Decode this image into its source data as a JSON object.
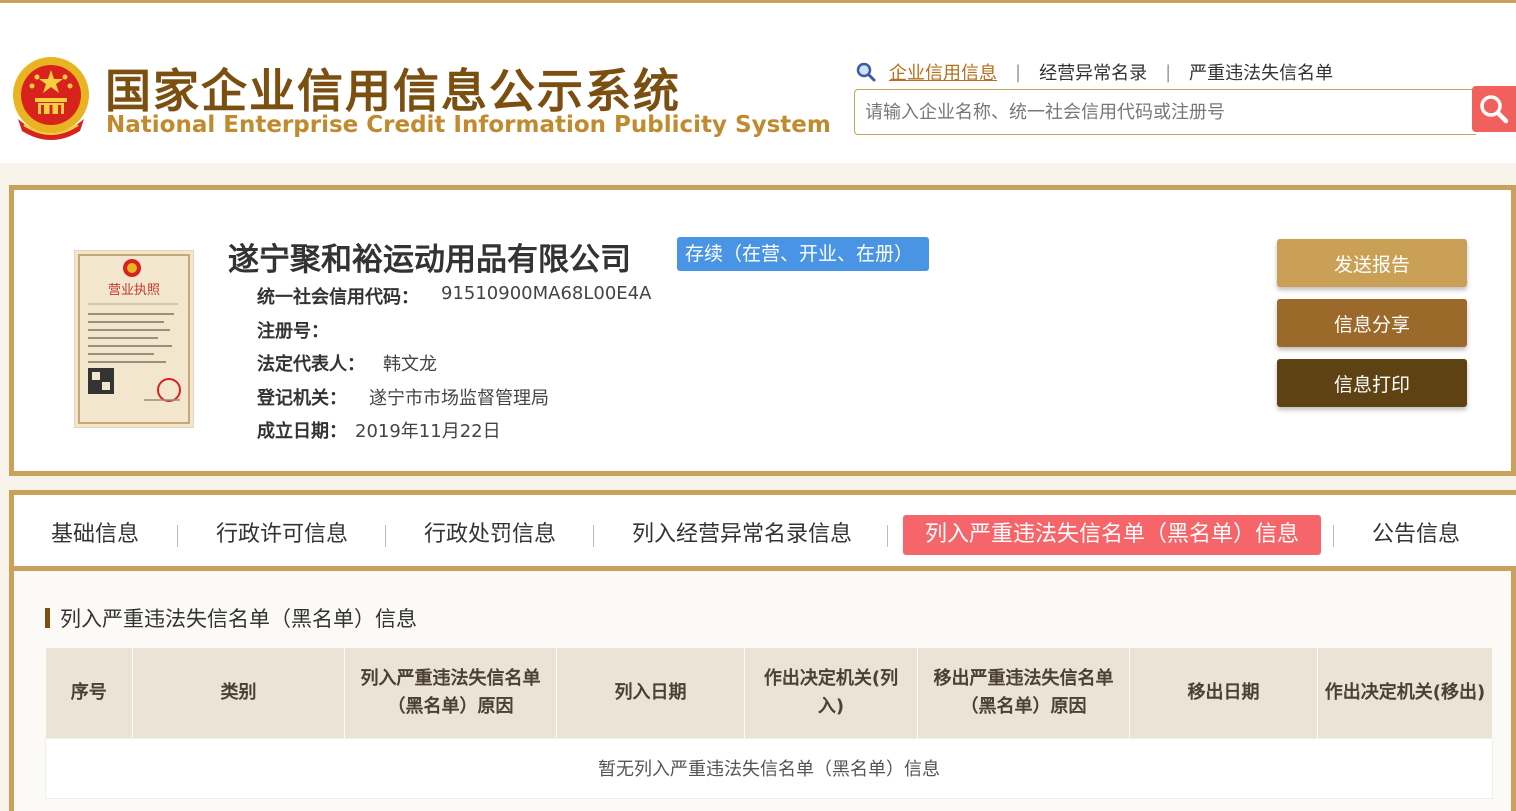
{
  "header": {
    "title": "国家企业信用信息公示系统",
    "subtitle": "National Enterprise Credit Information Publicity System",
    "nav": {
      "items": [
        "企业信用信息",
        "经营异常名录",
        "严重违法失信名单"
      ],
      "active_index": 0
    },
    "search": {
      "placeholder": "请输入企业名称、统一社会信用代码或注册号"
    }
  },
  "company": {
    "name": "遂宁聚和裕运动用品有限公司",
    "status": "存续（在营、开业、在册）",
    "license_title": "营业执照",
    "fields": [
      {
        "label": "统一社会信用代码：",
        "value": "91510900MA68L00E4A"
      },
      {
        "label": "注册号：",
        "value": ""
      },
      {
        "label": "法定代表人：",
        "value": "韩文龙"
      },
      {
        "label": "登记机关：",
        "value": "遂宁市市场监督管理局"
      },
      {
        "label": "成立日期：",
        "value": "2019年11月22日"
      }
    ],
    "actions": {
      "send": "发送报告",
      "share": "信息分享",
      "print": "信息打印"
    }
  },
  "tabs": {
    "items": [
      "基础信息",
      "行政许可信息",
      "行政处罚信息",
      "列入经营异常名录信息",
      "列入严重违法失信名单（黑名单）信息",
      "公告信息"
    ],
    "active_index": 4
  },
  "section": {
    "title": "列入严重违法失信名单（黑名单）信息",
    "table": {
      "columns": [
        "序号",
        "类别",
        "列入严重违法失信名单（黑名单）原因",
        "列入日期",
        "作出决定机关(列入)",
        "移出严重违法失信名单（黑名单）原因",
        "移出日期",
        "作出决定机关(移出)"
      ],
      "empty_text": "暂无列入严重违法失信名单（黑名单）信息"
    }
  },
  "colors": {
    "gold": "#c9a15a",
    "brown": "#7a4f0f",
    "active_tab": "#f5656a",
    "status_blue": "#4994e4",
    "search_red": "#f1605c"
  }
}
